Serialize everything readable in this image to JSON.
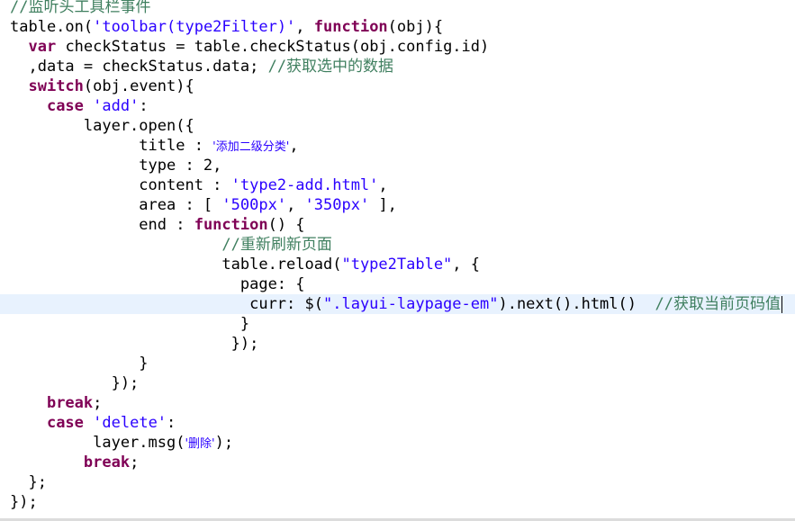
{
  "editor": {
    "colors": {
      "comment": "#3f7f5f",
      "keyword": "#7f0055",
      "string": "#2a00ff",
      "current_line": "#e8f2fe"
    },
    "lines": [
      [
        {
          "t": "//监听头工具栏事件",
          "k": "comment"
        }
      ],
      [
        {
          "t": "table.on("
        },
        {
          "t": "'toolbar(type2Filter)'",
          "k": "string"
        },
        {
          "t": ", "
        },
        {
          "t": "function",
          "k": "keyword"
        },
        {
          "t": "(obj){"
        }
      ],
      [
        {
          "t": "  "
        },
        {
          "t": "var",
          "k": "keyword"
        },
        {
          "t": " checkStatus = table.checkStatus(obj.config.id)"
        }
      ],
      [
        {
          "t": "  ,data = checkStatus.data; "
        },
        {
          "t": "//获取选中的数据",
          "k": "comment"
        }
      ],
      [
        {
          "t": "  "
        },
        {
          "t": "switch",
          "k": "keyword"
        },
        {
          "t": "(obj.event){"
        }
      ],
      [
        {
          "t": "    "
        },
        {
          "t": "case",
          "k": "keyword"
        },
        {
          "t": " "
        },
        {
          "t": "'add'",
          "k": "string"
        },
        {
          "t": ":"
        }
      ],
      [
        {
          "t": "        layer.open({"
        }
      ],
      [
        {
          "t": "              title : "
        },
        {
          "t": "'添加二级分类'",
          "k": "cjk-str"
        },
        {
          "t": ","
        }
      ],
      [
        {
          "t": "              type : 2,"
        }
      ],
      [
        {
          "t": "              content : "
        },
        {
          "t": "'type2-add.html'",
          "k": "string"
        },
        {
          "t": ","
        }
      ],
      [
        {
          "t": "              area : [ "
        },
        {
          "t": "'500px'",
          "k": "string"
        },
        {
          "t": ", "
        },
        {
          "t": "'350px'",
          "k": "string"
        },
        {
          "t": " ],"
        }
      ],
      [
        {
          "t": "              end : "
        },
        {
          "t": "function",
          "k": "keyword"
        },
        {
          "t": "() {"
        }
      ],
      [
        {
          "t": "                       "
        },
        {
          "t": "//重新刷新页面",
          "k": "comment"
        }
      ],
      [
        {
          "t": "                       table.reload("
        },
        {
          "t": "\"type2Table\"",
          "k": "string"
        },
        {
          "t": ", {"
        }
      ],
      [
        {
          "t": "                         page: {"
        }
      ],
      [
        {
          "t": "                          curr: $("
        },
        {
          "t": "\".layui-laypage-em\"",
          "k": "string"
        },
        {
          "t": ").next().html()  "
        },
        {
          "t": "//获取当前页码值",
          "k": "comment"
        }
      ],
      [
        {
          "t": "                         }"
        }
      ],
      [
        {
          "t": "                        });"
        }
      ],
      [
        {
          "t": "              }"
        }
      ],
      [
        {
          "t": "           });"
        }
      ],
      [
        {
          "t": "    "
        },
        {
          "t": "break",
          "k": "keyword"
        },
        {
          "t": ";"
        }
      ],
      [
        {
          "t": "    "
        },
        {
          "t": "case",
          "k": "keyword"
        },
        {
          "t": " "
        },
        {
          "t": "'delete'",
          "k": "string"
        },
        {
          "t": ":"
        }
      ],
      [
        {
          "t": "         layer.msg("
        },
        {
          "t": "'删除'",
          "k": "cjk-str"
        },
        {
          "t": ");"
        }
      ],
      [
        {
          "t": "        "
        },
        {
          "t": "break",
          "k": "keyword"
        },
        {
          "t": ";"
        }
      ],
      [
        {
          "t": "  };"
        }
      ],
      [
        {
          "t": "});"
        }
      ]
    ],
    "current_line": 15
  }
}
